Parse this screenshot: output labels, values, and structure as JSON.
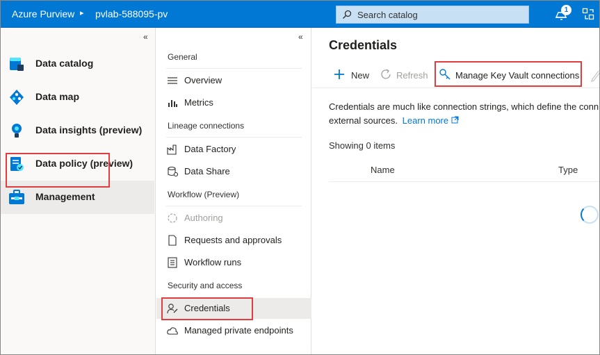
{
  "header": {
    "brand": "Azure Purview",
    "separator": "▸",
    "account": "pvlab-588095-pv",
    "search_placeholder": "Search catalog",
    "notification_count": "1",
    "bg_color": "#0078d4"
  },
  "leftnav": {
    "collapse": "«",
    "items": [
      {
        "label": "Data catalog",
        "icon": "data-catalog-icon"
      },
      {
        "label": "Data map",
        "icon": "data-map-icon"
      },
      {
        "label": "Data insights (preview)",
        "icon": "data-insights-icon"
      },
      {
        "label": "Data policy (preview)",
        "icon": "data-policy-icon"
      },
      {
        "label": "Management",
        "icon": "management-icon",
        "active": true
      }
    ]
  },
  "submenu": {
    "collapse": "«",
    "sections": {
      "general": "General",
      "lineage": "Lineage connections",
      "workflow": "Workflow (Preview)",
      "security": "Security and access"
    },
    "items": {
      "overview": "Overview",
      "metrics": "Metrics",
      "data_factory": "Data Factory",
      "data_share": "Data Share",
      "authoring": "Authoring",
      "requests": "Requests and approvals",
      "workflow_runs": "Workflow runs",
      "credentials": "Credentials",
      "private_endpoints": "Managed private endpoints"
    }
  },
  "main": {
    "title": "Credentials",
    "toolbar": {
      "new": "New",
      "refresh": "Refresh",
      "manage_kv": "Manage Key Vault connections"
    },
    "description_line1": "Credentials are much like connection strings, which define the conn",
    "description_line2": "external sources.",
    "learn_more": "Learn more",
    "showing": "Showing 0 items",
    "columns": {
      "name": "Name",
      "type": "Type"
    }
  },
  "colors": {
    "accent": "#0078d4",
    "highlight": "#e03e3e",
    "active_bg": "#edebe9"
  }
}
